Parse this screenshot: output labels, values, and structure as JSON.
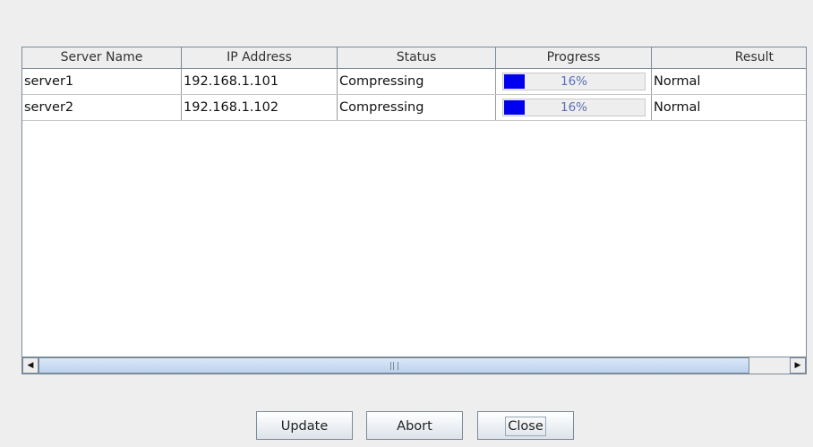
{
  "table": {
    "columns": [
      "Server Name",
      "IP Address",
      "Status",
      "Progress",
      "Result"
    ],
    "rows": [
      {
        "server_name": "server1",
        "ip_address": "192.168.1.101",
        "status": "Compressing",
        "progress": 0.16,
        "progress_label": "16%",
        "result": "Normal"
      },
      {
        "server_name": "server2",
        "ip_address": "192.168.1.102",
        "status": "Compressing",
        "progress": 0.16,
        "progress_label": "16%",
        "result": "Normal"
      }
    ]
  },
  "scrollbar": {
    "left_icon": "arrow-left-icon",
    "right_icon": "arrow-right-icon",
    "grip_icon": "grip-icon"
  },
  "buttons": {
    "update": "Update",
    "abort": "Abort",
    "close": "Close"
  },
  "colors": {
    "progress_fill": "#0000ee",
    "progress_text": "#5a6fb3",
    "background": "#eeeeee"
  }
}
